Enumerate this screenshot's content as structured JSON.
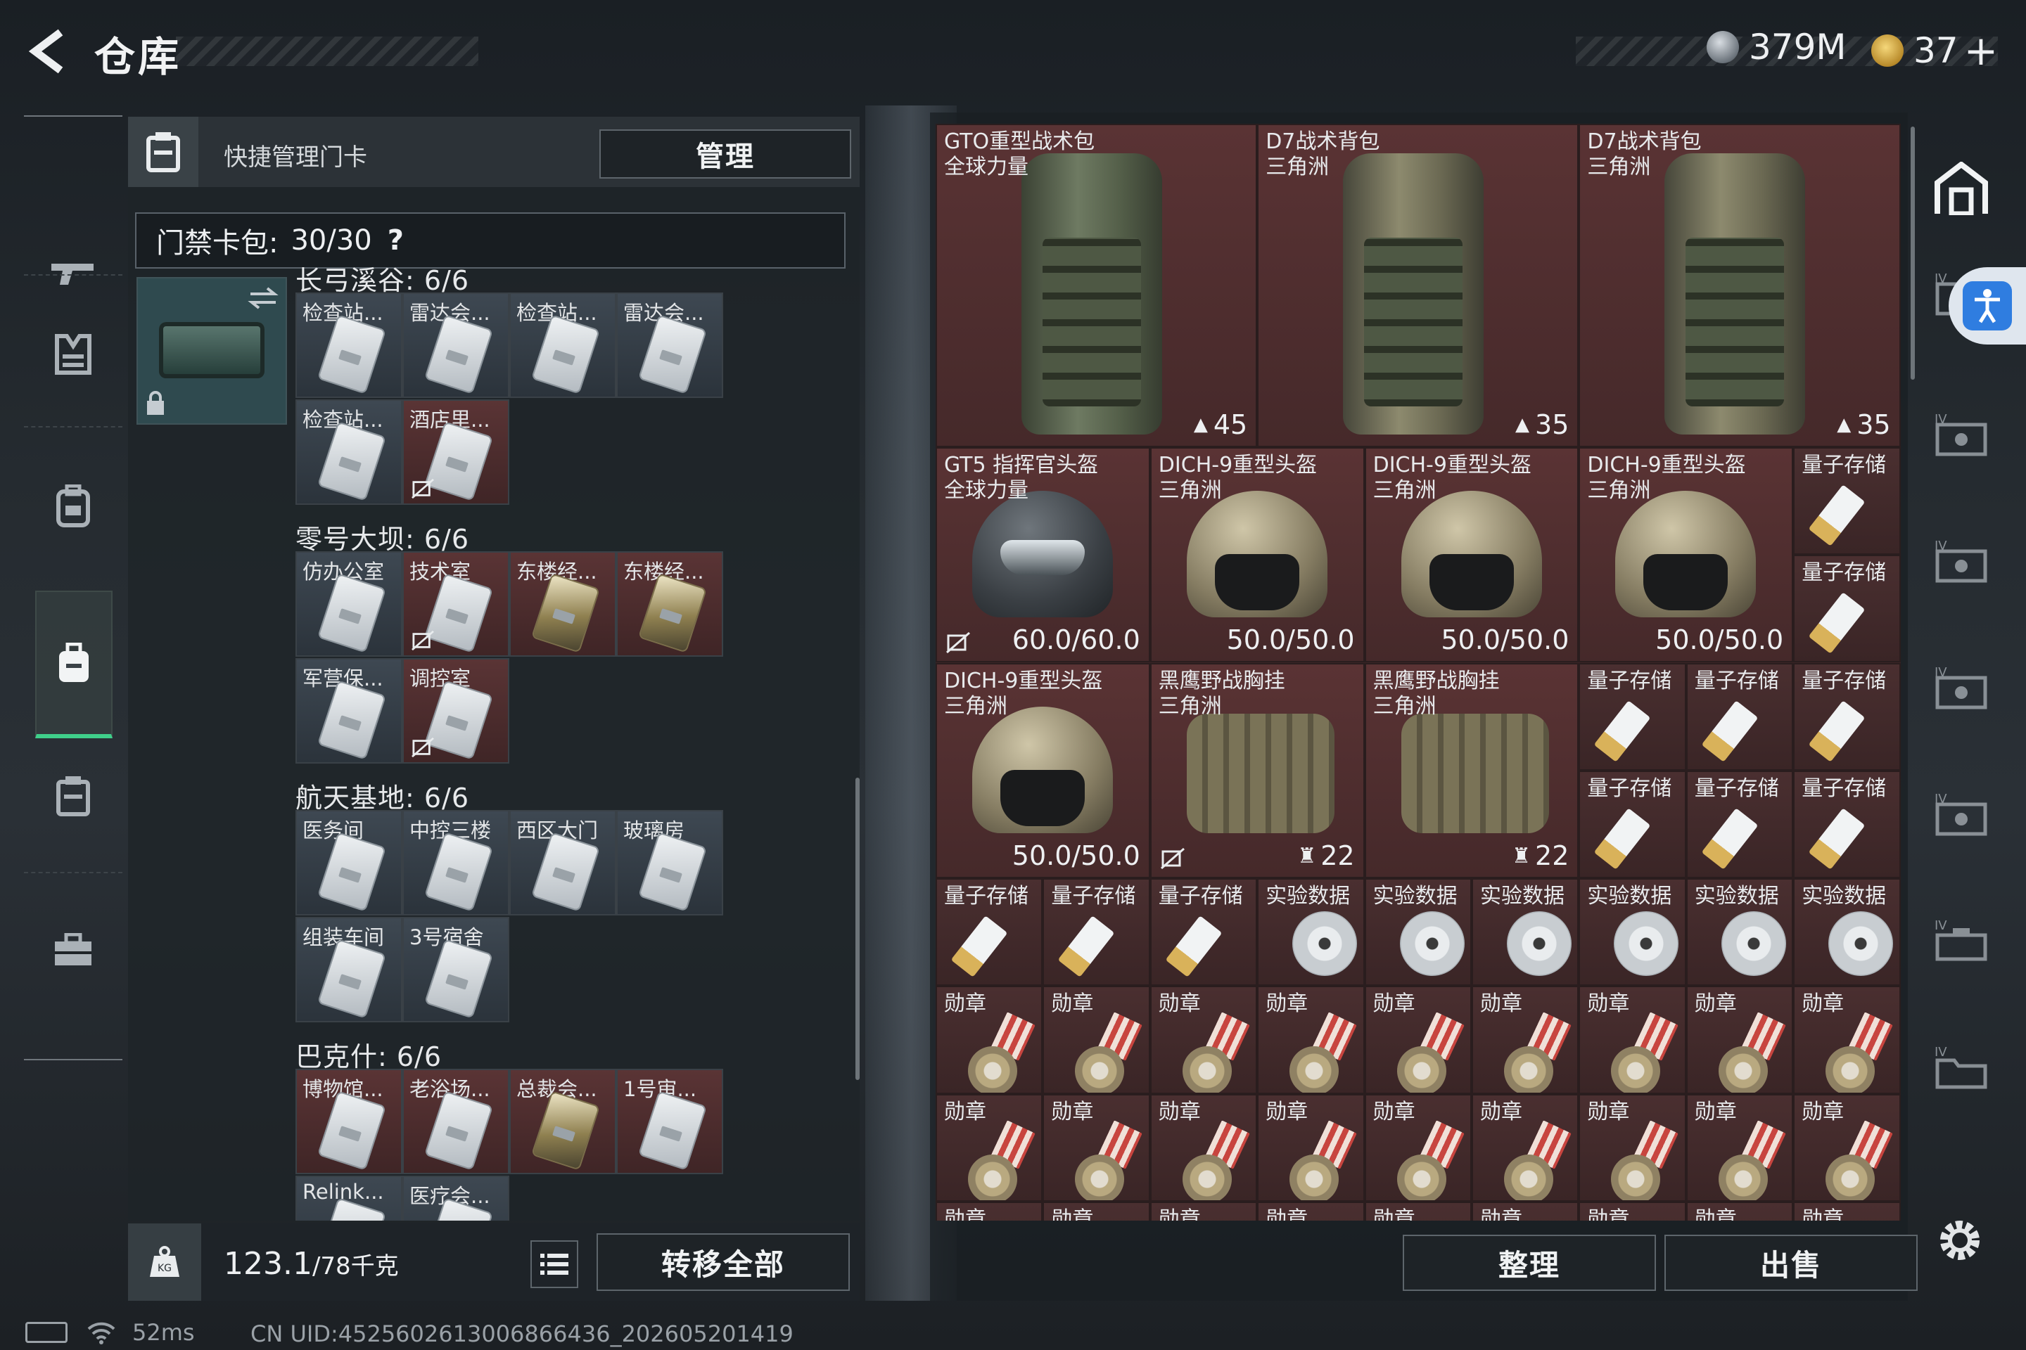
{
  "header": {
    "title": "仓库",
    "currency1": "379M",
    "currency2": "37"
  },
  "left": {
    "card_header_title": "快捷管理门卡",
    "manage_label": "管理",
    "pack_label": "门禁卡包:",
    "pack_count": "30/30",
    "pack_help": "?",
    "regions": [
      {
        "title": "长弓溪谷: 6/6",
        "cards": [
          {
            "label": "检查站...",
            "color": "blue",
            "gold": false,
            "nobind": false
          },
          {
            "label": "雷达会...",
            "color": "blue",
            "gold": false,
            "nobind": false
          },
          {
            "label": "检查站...",
            "color": "blue",
            "gold": false,
            "nobind": false
          },
          {
            "label": "雷达会...",
            "color": "blue",
            "gold": false,
            "nobind": false
          },
          {
            "label": "检查站...",
            "color": "blue",
            "gold": false,
            "nobind": false
          },
          {
            "label": "酒店里...",
            "color": "red",
            "gold": false,
            "nobind": true
          }
        ]
      },
      {
        "title": "零号大坝: 6/6",
        "cards": [
          {
            "label": "仿办公室",
            "color": "blue",
            "gold": false,
            "nobind": false
          },
          {
            "label": "技术室",
            "color": "red",
            "gold": false,
            "nobind": true
          },
          {
            "label": "东楼经...",
            "color": "red",
            "gold": true,
            "nobind": false
          },
          {
            "label": "东楼经...",
            "color": "red",
            "gold": true,
            "nobind": false
          },
          {
            "label": "军营保...",
            "color": "blue",
            "gold": false,
            "nobind": false
          },
          {
            "label": "调控室",
            "color": "red",
            "gold": false,
            "nobind": true
          }
        ]
      },
      {
        "title": "航天基地: 6/6",
        "cards": [
          {
            "label": "医务间",
            "color": "blue",
            "gold": false,
            "nobind": false
          },
          {
            "label": "中控三楼",
            "color": "blue",
            "gold": false,
            "nobind": false
          },
          {
            "label": "西区大门",
            "color": "blue",
            "gold": false,
            "nobind": false
          },
          {
            "label": "玻璃房",
            "color": "blue",
            "gold": false,
            "nobind": false
          },
          {
            "label": "组装车间",
            "color": "blue",
            "gold": false,
            "nobind": false
          },
          {
            "label": "3号宿舍",
            "color": "blue",
            "gold": false,
            "nobind": false
          }
        ]
      },
      {
        "title": "巴克什: 6/6",
        "cards": [
          {
            "label": "博物馆...",
            "color": "red",
            "gold": false,
            "nobind": false
          },
          {
            "label": "老浴场...",
            "color": "red",
            "gold": false,
            "nobind": false
          },
          {
            "label": "总裁会...",
            "color": "red",
            "gold": true,
            "nobind": false
          },
          {
            "label": "1号审...",
            "color": "red",
            "gold": false,
            "nobind": false
          },
          {
            "label": "Relink...",
            "color": "blue",
            "gold": false,
            "nobind": false
          },
          {
            "label": "医疗会...",
            "color": "blue",
            "gold": false,
            "nobind": false
          }
        ]
      }
    ],
    "weight_value": "123.1",
    "weight_max": "/78千克",
    "transfer_label": "转移全部"
  },
  "grid": {
    "items": [
      {
        "kind": "bag",
        "name": "GTO重型战术包",
        "sub": "全球力量",
        "value": "45",
        "nobind": true
      },
      {
        "kind": "bag",
        "name": "D7战术背包",
        "sub": "三角洲",
        "value": "35",
        "nobind": true
      },
      {
        "kind": "bag",
        "name": "D7战术背包",
        "sub": "三角洲",
        "value": "35",
        "nobind": false
      },
      {
        "kind": "helmet",
        "name": "GT5 指挥官头盔",
        "sub": "全球力量",
        "value": "60.0/60.0",
        "nobind": true
      },
      {
        "kind": "helmet",
        "name": "DICH-9重型头盔",
        "sub": "三角洲",
        "value": "50.0/50.0",
        "nobind": false
      },
      {
        "kind": "helmet",
        "name": "DICH-9重型头盔",
        "sub": "三角洲",
        "value": "50.0/50.0",
        "nobind": false
      },
      {
        "kind": "helmet",
        "name": "DICH-9重型头盔",
        "sub": "三角洲",
        "value": "50.0/50.0",
        "nobind": false
      },
      {
        "kind": "helmet",
        "name": "DICH-9重型头盔",
        "sub": "三角洲",
        "value": "50.0/50.0",
        "nobind": false
      },
      {
        "kind": "vest",
        "name": "黑鹰野战胸挂",
        "sub": "三角洲",
        "value": "22",
        "nobind": true
      },
      {
        "kind": "vest",
        "name": "黑鹰野战胸挂",
        "sub": "三角洲",
        "value": "22",
        "nobind": false
      }
    ],
    "usb_label": "量子存储",
    "disc_label": "实验数据",
    "medal_label": "勋章"
  },
  "buttons": {
    "sort": "整理",
    "sell": "出售"
  },
  "status": {
    "ping": "52ms",
    "uid": "CN UID:4525602613006866436_202605201419"
  }
}
